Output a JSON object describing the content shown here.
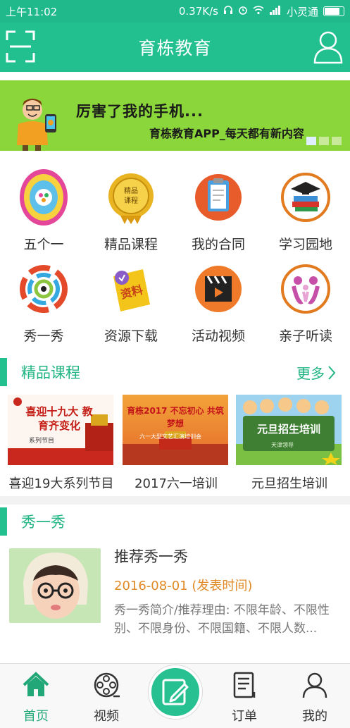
{
  "status_bar": {
    "time": "上午11:02",
    "network_speed": "0.37K/s",
    "carrier": "小灵通"
  },
  "header": {
    "title": "育栋教育"
  },
  "banner": {
    "line1": "厉害了我的手机...",
    "line2": "育栋教育APP_每天都有新内容"
  },
  "menu_grid": [
    {
      "label": "五个一",
      "icon": "five-one-icon"
    },
    {
      "label": "精品课程",
      "icon": "premium-course-icon"
    },
    {
      "label": "我的合同",
      "icon": "contract-icon"
    },
    {
      "label": "学习园地",
      "icon": "study-books-icon"
    },
    {
      "label": "秀一秀",
      "icon": "show-icon"
    },
    {
      "label": "资源下载",
      "icon": "download-icon"
    },
    {
      "label": "活动视频",
      "icon": "video-clapper-icon"
    },
    {
      "label": "亲子听读",
      "icon": "parent-child-icon"
    }
  ],
  "courses_section": {
    "title": "精品课程",
    "more_label": "更多",
    "items": [
      {
        "title": "喜迎19大系列节目",
        "thumb_text": "喜迎十九大 教育齐变化",
        "thumb_sub": "系列节目"
      },
      {
        "title": "2017六一培训",
        "thumb_text": "育栋2017 不忘初心 共筑梦想",
        "thumb_sub": "六一大型文艺汇演培训会"
      },
      {
        "title": "元旦招生培训",
        "thumb_text": "元旦招生培训",
        "thumb_sub": "天津领导"
      }
    ]
  },
  "show_section": {
    "title": "秀一秀",
    "item": {
      "title": "推荐秀一秀",
      "date": "2016-08-01 (发表时间)",
      "description": "秀一秀简介/推荐理由: 不限年龄、不限性别、不限身份、不限国籍、不限人数..."
    }
  },
  "bottom_nav": [
    {
      "label": "首页",
      "icon": "home-icon",
      "active": true
    },
    {
      "label": "视频",
      "icon": "film-reel-icon",
      "active": false
    },
    {
      "label": "",
      "icon": "edit-icon",
      "active": false
    },
    {
      "label": "订单",
      "icon": "order-icon",
      "active": false
    },
    {
      "label": "我的",
      "icon": "profile-icon",
      "active": false
    }
  ],
  "colors": {
    "primary": "#22c08f",
    "banner": "#8bd63a",
    "date": "#e08a28"
  }
}
